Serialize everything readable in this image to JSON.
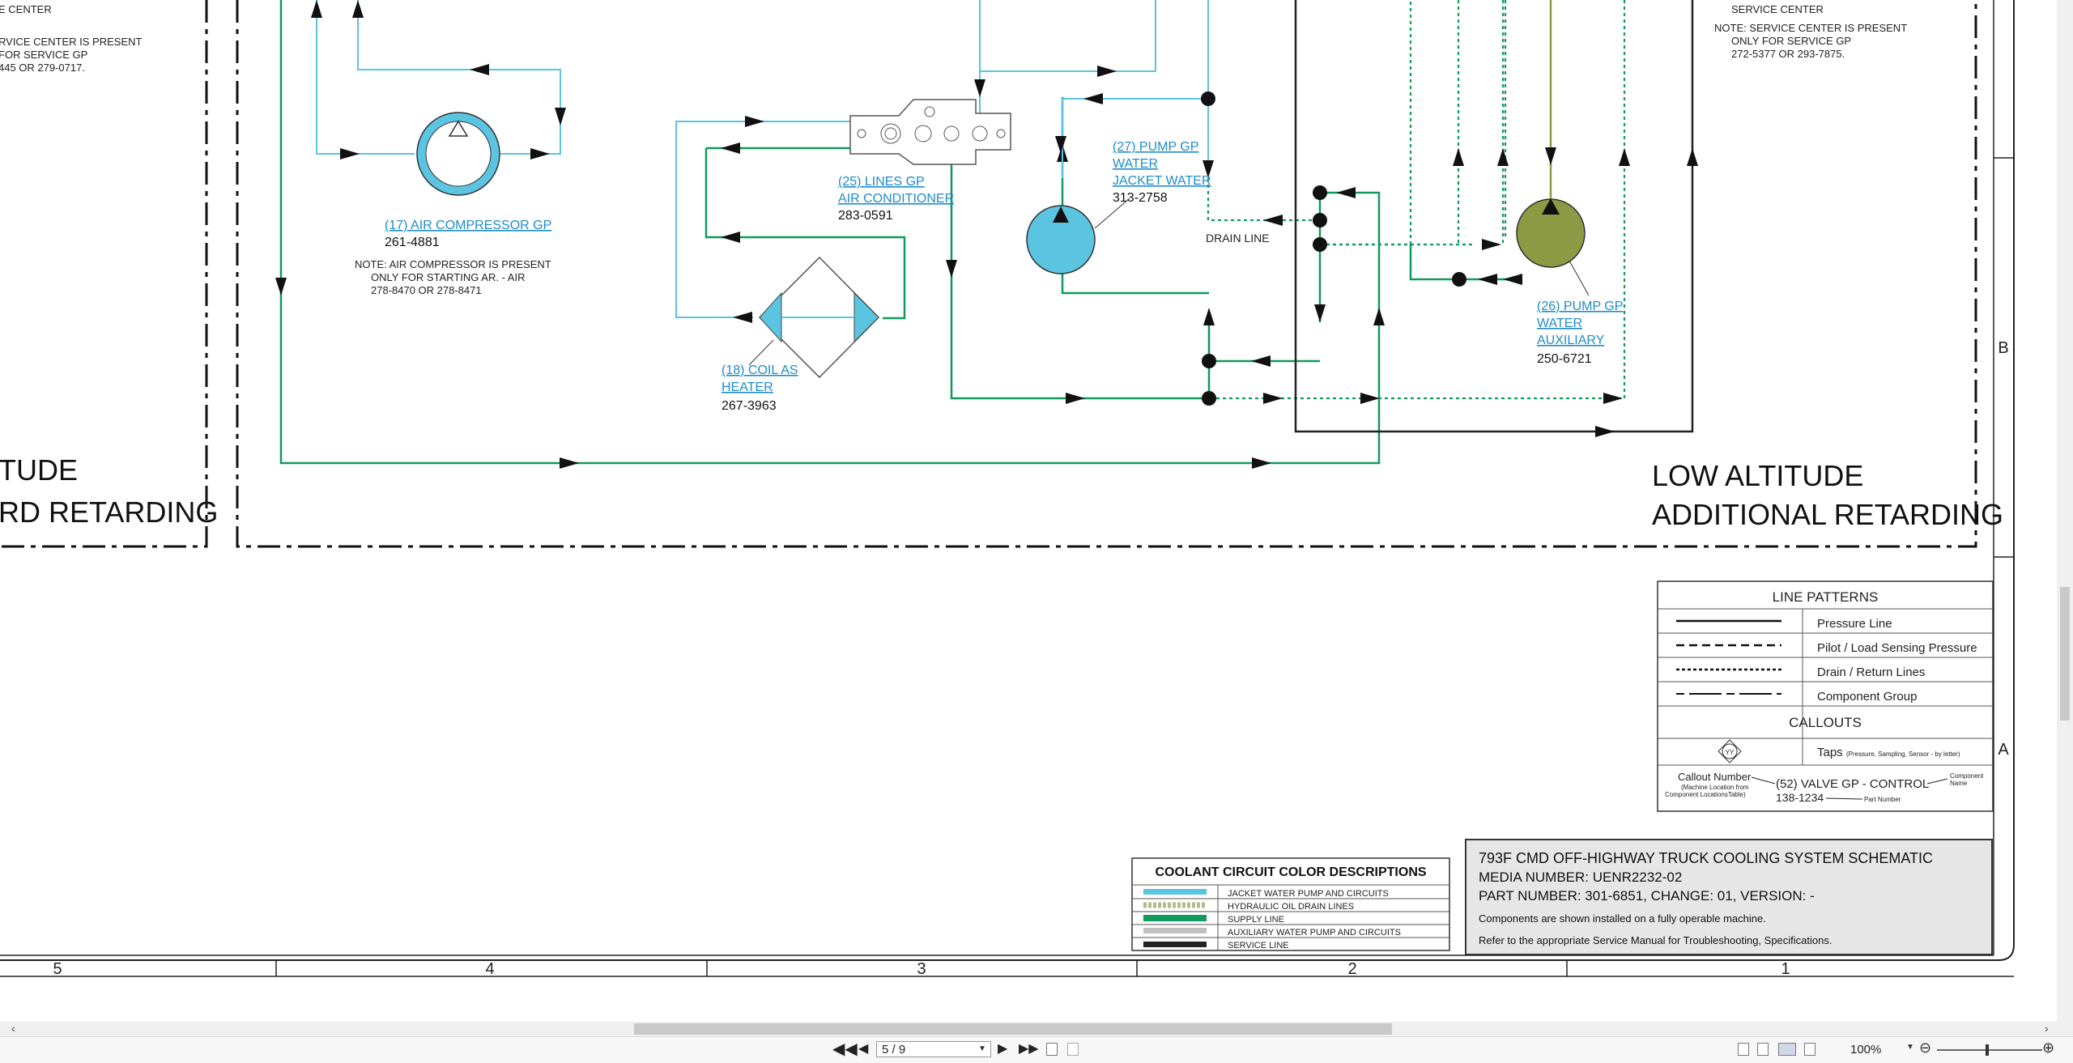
{
  "components": {
    "air_compressor": {
      "link": "(17) AIR COMPRESSOR GP",
      "part": "261-4881",
      "note": [
        "NOTE: AIR COMPRESSOR IS PRESENT",
        "ONLY FOR STARTING AR. - AIR",
        "278-8470 OR 278-8471"
      ]
    },
    "lines_ac": {
      "link": [
        "(25) LINES GP",
        "AIR CONDITIONER"
      ],
      "part": "283-0591"
    },
    "coil_heater": {
      "link": [
        "(18) COIL AS",
        "HEATER"
      ],
      "part": "267-3963"
    },
    "pump_jacket": {
      "link": [
        "(27) PUMP GP",
        "WATER",
        "JACKET WATER"
      ],
      "part": "313-2758"
    },
    "pump_aux": {
      "link": [
        "(26) PUMP GP",
        "WATER",
        "AUXILIARY"
      ],
      "part": "250-6721"
    }
  },
  "labels": {
    "drain_line": "DRAIN LINE",
    "left_note": [
      "E CENTER",
      "RVICE CENTER IS PRESENT",
      "FOR SERVICE GP",
      "445 OR 279-0717."
    ],
    "right_note": [
      "SERVICE CENTER",
      "NOTE: SERVICE CENTER IS PRESENT",
      "ONLY FOR SERVICE GP",
      "272-5377 OR 293-7875."
    ],
    "left_box_title": [
      "TUDE",
      "RD RETARDING"
    ],
    "right_box_title": [
      "LOW ALTITUDE",
      "ADDITIONAL RETARDING"
    ]
  },
  "row_letters": [
    "B",
    "A"
  ],
  "column_numbers": [
    "5",
    "4",
    "3",
    "2",
    "1"
  ],
  "line_patterns": {
    "header": "LINE PATTERNS",
    "items": [
      "Pressure Line",
      "Pilot / Load Sensing Pressure",
      "Drain / Return Lines",
      "Component Group"
    ],
    "callouts_header": "CALLOUTS",
    "taps_label": "Taps",
    "taps_detail": "(Pressure, Sampling, Sensor - by letter)",
    "taps_symbol": "YY",
    "callout_number": "Callout Number",
    "callout_number_sub": [
      "(Machine Location from",
      "Component LocationsTable)"
    ],
    "example_name": "(52) VALVE GP - CONTROL",
    "example_part": "138-1234",
    "component_name": [
      "Component",
      "Name"
    ],
    "part_number": "Part Number"
  },
  "color_legend": {
    "title": "COOLANT CIRCUIT COLOR DESCRIPTIONS",
    "items": [
      {
        "label": "JACKET WATER PUMP AND CIRCUITS",
        "color": "#5bc4e1"
      },
      {
        "label": "HYDRAULIC OIL DRAIN LINES",
        "color": "#b0bd8a"
      },
      {
        "label": "SUPPLY LINE",
        "color": "#109a5c"
      },
      {
        "label": "AUXILIARY WATER PUMP AND CIRCUITS",
        "color": "#c0c0c0"
      },
      {
        "label": "SERVICE LINE",
        "color": "#222222"
      }
    ]
  },
  "title_block": {
    "title": "793F CMD OFF-HIGHWAY TRUCK COOLING SYSTEM SCHEMATIC",
    "media": "MEDIA NUMBER: UENR2232-02",
    "part": "PART NUMBER: 301-6851, CHANGE: 01, VERSION: -",
    "note1": "Components are shown installed on a fully operable machine.",
    "note2": "Refer to the appropriate Service Manual for Troubleshooting, Specifications."
  },
  "toolbar": {
    "page": "5 / 9",
    "zoom": "100%"
  },
  "colors": {
    "jacket": "#5bc4e1",
    "supply": "#109a5c",
    "aux": "#8c9a44",
    "service": "#222222",
    "link": "#1e8cc8"
  }
}
